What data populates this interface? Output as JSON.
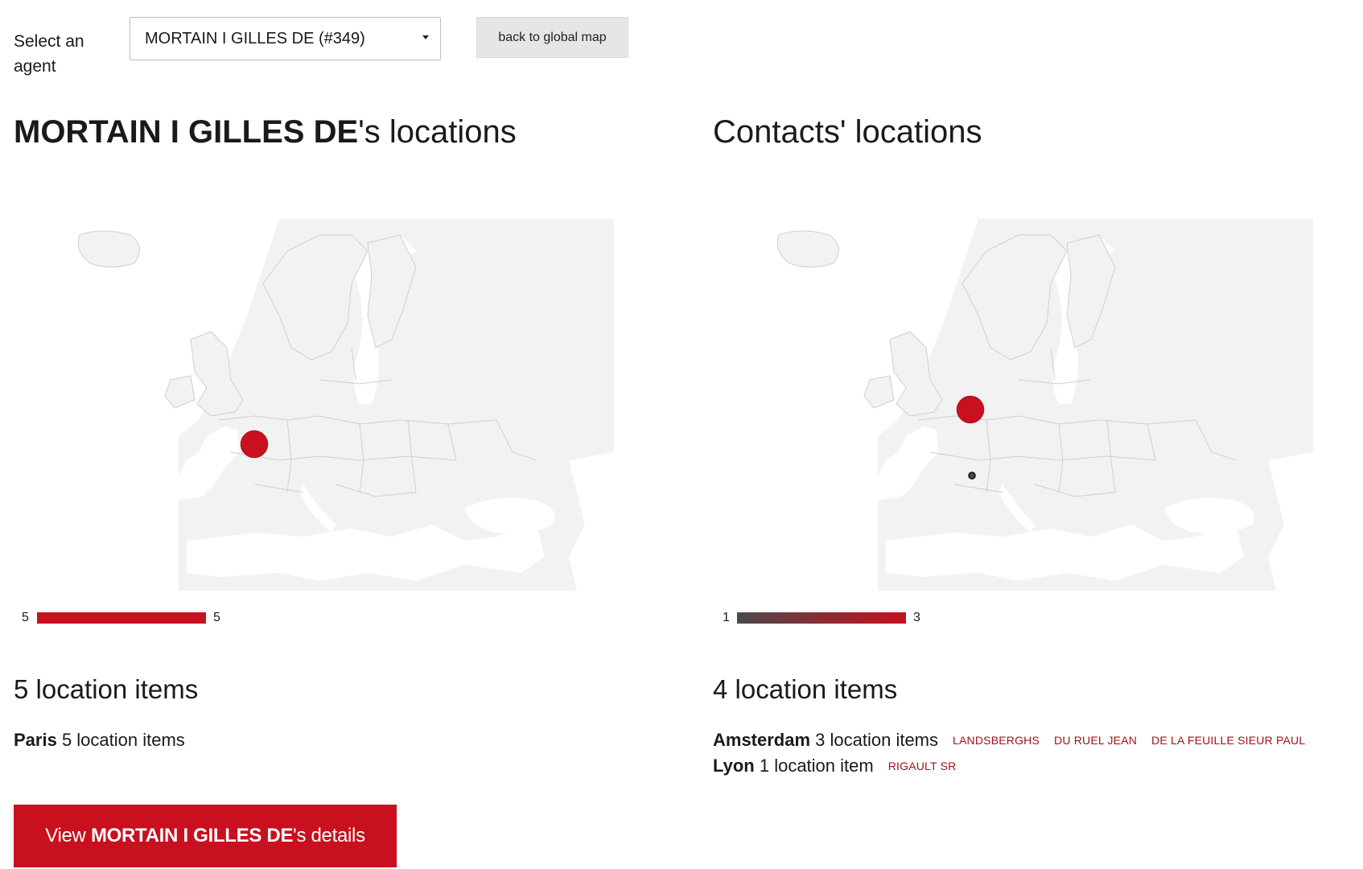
{
  "selector": {
    "label": "Select an agent",
    "selected": "MORTAIN I GILLES DE (#349)",
    "back_label": "back to global map"
  },
  "left": {
    "heading_name": "MORTAIN I GILLES DE",
    "heading_suffix": "'s locations",
    "legend_min": "5",
    "legend_max": "5",
    "legend_color_from": "#c8101e",
    "legend_color_to": "#c8101e",
    "count_label": "5 location items",
    "locations": [
      {
        "city": "Paris",
        "items": "5 location items",
        "contacts": []
      }
    ],
    "markers": [
      {
        "city": "Paris",
        "value": 5
      }
    ]
  },
  "right": {
    "heading": "Contacts' locations",
    "legend_min": "1",
    "legend_max": "3",
    "legend_color_from": "#4a4a4a",
    "legend_color_to": "#c8101e",
    "count_label": "4 location items",
    "locations": [
      {
        "city": "Amsterdam",
        "items": "3 location items",
        "contacts": [
          "LANDSBERGHS",
          "DU RUEL JEAN",
          "DE LA FEUILLE SIEUR PAUL"
        ]
      },
      {
        "city": "Lyon",
        "items": "1 location item",
        "contacts": [
          "RIGAULT SR"
        ]
      }
    ],
    "markers": [
      {
        "city": "Amsterdam",
        "value": 3
      },
      {
        "city": "Lyon",
        "value": 1
      }
    ]
  },
  "details_button": {
    "prefix": "View ",
    "name": "MORTAIN I GILLES DE",
    "suffix": "'s details"
  },
  "colors": {
    "accent": "#c8101e",
    "map_land": "#f2f2f2",
    "map_border": "#cfcfcf"
  }
}
